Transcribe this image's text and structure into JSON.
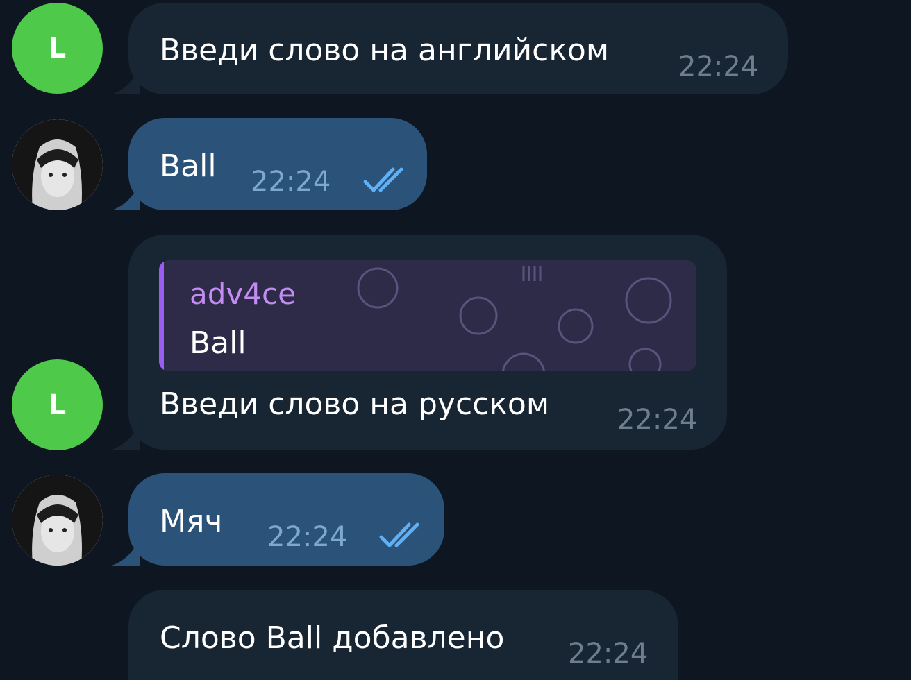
{
  "colors": {
    "background": "#0e1621",
    "incoming_bubble": "#182533",
    "outgoing_bubble": "#2b5278",
    "bot_avatar": "#4fc94a",
    "read_ticks": "#5fb0f5",
    "reply_accent": "#9b5cf0"
  },
  "bot_avatar_letter": "L",
  "messages": [
    {
      "direction": "incoming",
      "text": "Введи слово на английском",
      "time": "22:24"
    },
    {
      "direction": "outgoing",
      "text": "Ball",
      "time": "22:24",
      "status_icon": "double-check-icon"
    },
    {
      "direction": "incoming",
      "reply": {
        "author": "adv4ce",
        "text": "Ball"
      },
      "text": "Введи слово на русском",
      "time": "22:24"
    },
    {
      "direction": "outgoing",
      "text": "Мяч",
      "time": "22:24",
      "status_icon": "double-check-icon"
    },
    {
      "direction": "incoming",
      "text": "Слово Ball добавлено",
      "time": "22:24"
    }
  ]
}
